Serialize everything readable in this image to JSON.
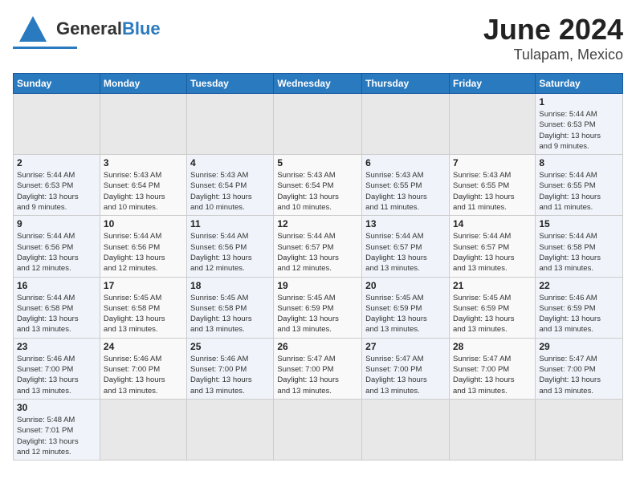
{
  "header": {
    "logo": {
      "general": "General",
      "blue": "Blue"
    },
    "title": "June 2024",
    "subtitle": "Tulapam, Mexico"
  },
  "weekdays": [
    "Sunday",
    "Monday",
    "Tuesday",
    "Wednesday",
    "Thursday",
    "Friday",
    "Saturday"
  ],
  "weeks": [
    [
      {
        "day": "",
        "info": ""
      },
      {
        "day": "",
        "info": ""
      },
      {
        "day": "",
        "info": ""
      },
      {
        "day": "",
        "info": ""
      },
      {
        "day": "",
        "info": ""
      },
      {
        "day": "",
        "info": ""
      },
      {
        "day": "1",
        "info": "Sunrise: 5:44 AM\nSunset: 6:53 PM\nDaylight: 13 hours\nand 9 minutes."
      }
    ],
    [
      {
        "day": "2",
        "info": "Sunrise: 5:44 AM\nSunset: 6:53 PM\nDaylight: 13 hours\nand 9 minutes."
      },
      {
        "day": "3",
        "info": "Sunrise: 5:43 AM\nSunset: 6:54 PM\nDaylight: 13 hours\nand 10 minutes."
      },
      {
        "day": "4",
        "info": "Sunrise: 5:43 AM\nSunset: 6:54 PM\nDaylight: 13 hours\nand 10 minutes."
      },
      {
        "day": "5",
        "info": "Sunrise: 5:43 AM\nSunset: 6:54 PM\nDaylight: 13 hours\nand 10 minutes."
      },
      {
        "day": "6",
        "info": "Sunrise: 5:43 AM\nSunset: 6:55 PM\nDaylight: 13 hours\nand 11 minutes."
      },
      {
        "day": "7",
        "info": "Sunrise: 5:43 AM\nSunset: 6:55 PM\nDaylight: 13 hours\nand 11 minutes."
      },
      {
        "day": "8",
        "info": "Sunrise: 5:44 AM\nSunset: 6:55 PM\nDaylight: 13 hours\nand 11 minutes."
      }
    ],
    [
      {
        "day": "9",
        "info": "Sunrise: 5:44 AM\nSunset: 6:56 PM\nDaylight: 13 hours\nand 12 minutes."
      },
      {
        "day": "10",
        "info": "Sunrise: 5:44 AM\nSunset: 6:56 PM\nDaylight: 13 hours\nand 12 minutes."
      },
      {
        "day": "11",
        "info": "Sunrise: 5:44 AM\nSunset: 6:56 PM\nDaylight: 13 hours\nand 12 minutes."
      },
      {
        "day": "12",
        "info": "Sunrise: 5:44 AM\nSunset: 6:57 PM\nDaylight: 13 hours\nand 12 minutes."
      },
      {
        "day": "13",
        "info": "Sunrise: 5:44 AM\nSunset: 6:57 PM\nDaylight: 13 hours\nand 13 minutes."
      },
      {
        "day": "14",
        "info": "Sunrise: 5:44 AM\nSunset: 6:57 PM\nDaylight: 13 hours\nand 13 minutes."
      },
      {
        "day": "15",
        "info": "Sunrise: 5:44 AM\nSunset: 6:58 PM\nDaylight: 13 hours\nand 13 minutes."
      }
    ],
    [
      {
        "day": "16",
        "info": "Sunrise: 5:44 AM\nSunset: 6:58 PM\nDaylight: 13 hours\nand 13 minutes."
      },
      {
        "day": "17",
        "info": "Sunrise: 5:45 AM\nSunset: 6:58 PM\nDaylight: 13 hours\nand 13 minutes."
      },
      {
        "day": "18",
        "info": "Sunrise: 5:45 AM\nSunset: 6:58 PM\nDaylight: 13 hours\nand 13 minutes."
      },
      {
        "day": "19",
        "info": "Sunrise: 5:45 AM\nSunset: 6:59 PM\nDaylight: 13 hours\nand 13 minutes."
      },
      {
        "day": "20",
        "info": "Sunrise: 5:45 AM\nSunset: 6:59 PM\nDaylight: 13 hours\nand 13 minutes."
      },
      {
        "day": "21",
        "info": "Sunrise: 5:45 AM\nSunset: 6:59 PM\nDaylight: 13 hours\nand 13 minutes."
      },
      {
        "day": "22",
        "info": "Sunrise: 5:46 AM\nSunset: 6:59 PM\nDaylight: 13 hours\nand 13 minutes."
      }
    ],
    [
      {
        "day": "23",
        "info": "Sunrise: 5:46 AM\nSunset: 7:00 PM\nDaylight: 13 hours\nand 13 minutes."
      },
      {
        "day": "24",
        "info": "Sunrise: 5:46 AM\nSunset: 7:00 PM\nDaylight: 13 hours\nand 13 minutes."
      },
      {
        "day": "25",
        "info": "Sunrise: 5:46 AM\nSunset: 7:00 PM\nDaylight: 13 hours\nand 13 minutes."
      },
      {
        "day": "26",
        "info": "Sunrise: 5:47 AM\nSunset: 7:00 PM\nDaylight: 13 hours\nand 13 minutes."
      },
      {
        "day": "27",
        "info": "Sunrise: 5:47 AM\nSunset: 7:00 PM\nDaylight: 13 hours\nand 13 minutes."
      },
      {
        "day": "28",
        "info": "Sunrise: 5:47 AM\nSunset: 7:00 PM\nDaylight: 13 hours\nand 13 minutes."
      },
      {
        "day": "29",
        "info": "Sunrise: 5:47 AM\nSunset: 7:00 PM\nDaylight: 13 hours\nand 13 minutes."
      }
    ],
    [
      {
        "day": "30",
        "info": "Sunrise: 5:48 AM\nSunset: 7:01 PM\nDaylight: 13 hours\nand 12 minutes."
      },
      {
        "day": "",
        "info": ""
      },
      {
        "day": "",
        "info": ""
      },
      {
        "day": "",
        "info": ""
      },
      {
        "day": "",
        "info": ""
      },
      {
        "day": "",
        "info": ""
      },
      {
        "day": "",
        "info": ""
      }
    ]
  ]
}
